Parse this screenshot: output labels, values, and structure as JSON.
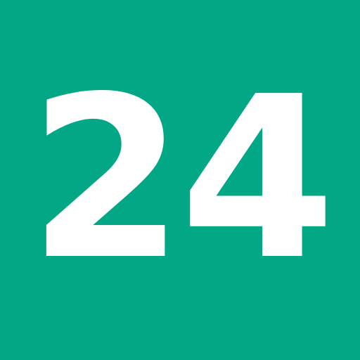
{
  "tile": {
    "number": "24",
    "background_color": "#02a886",
    "text_color": "#ffffff"
  }
}
